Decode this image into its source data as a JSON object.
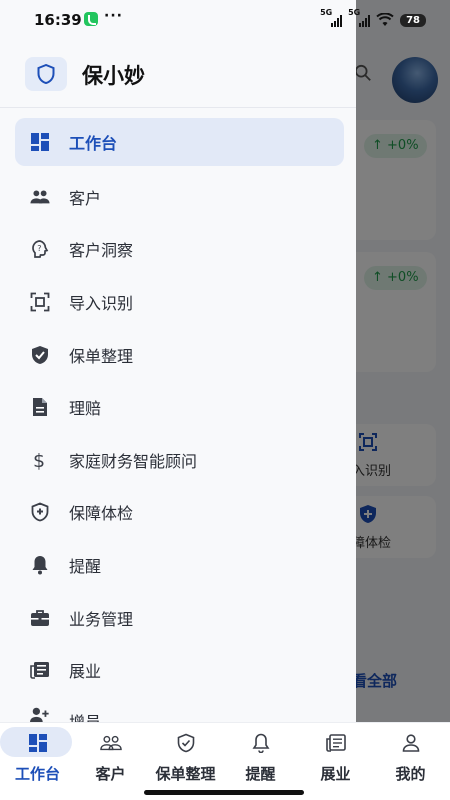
{
  "status": {
    "time": "16:39",
    "dots": "···",
    "sim1": "5G",
    "sim2": "5G",
    "battery": "78"
  },
  "drawer": {
    "app_title": "保小妙",
    "items": [
      {
        "label": "工作台",
        "icon": "dashboard-icon",
        "active": true
      },
      {
        "label": "客户",
        "icon": "people-icon"
      },
      {
        "label": "客户洞察",
        "icon": "insight-icon"
      },
      {
        "label": "导入识别",
        "icon": "scan-icon"
      },
      {
        "label": "保单整理",
        "icon": "shield-check-icon"
      },
      {
        "label": "理赔",
        "icon": "document-icon"
      },
      {
        "label": "家庭财务智能顾问",
        "icon": "dollar-icon"
      },
      {
        "label": "保障体检",
        "icon": "shield-plus-icon"
      },
      {
        "label": "提醒",
        "icon": "bell-icon"
      },
      {
        "label": "业务管理",
        "icon": "briefcase-icon"
      },
      {
        "label": "展业",
        "icon": "newspaper-icon"
      },
      {
        "label": "增员",
        "icon": "person-add-icon"
      }
    ]
  },
  "background": {
    "stat1_change": "↑ +0%",
    "stat2_change": "↑ +0%",
    "tile1_label": "入识别",
    "tile2_label": "障体检",
    "view_all": "看全部"
  },
  "bottom_nav": {
    "tabs": [
      {
        "label": "工作台",
        "active": true
      },
      {
        "label": "客户"
      },
      {
        "label": "保单整理"
      },
      {
        "label": "提醒"
      },
      {
        "label": "展业"
      },
      {
        "label": "我的"
      }
    ]
  },
  "colors": {
    "accent": "#1d4fb8",
    "active_bg": "#e2e9f7",
    "positive": "#1e9a4a"
  }
}
